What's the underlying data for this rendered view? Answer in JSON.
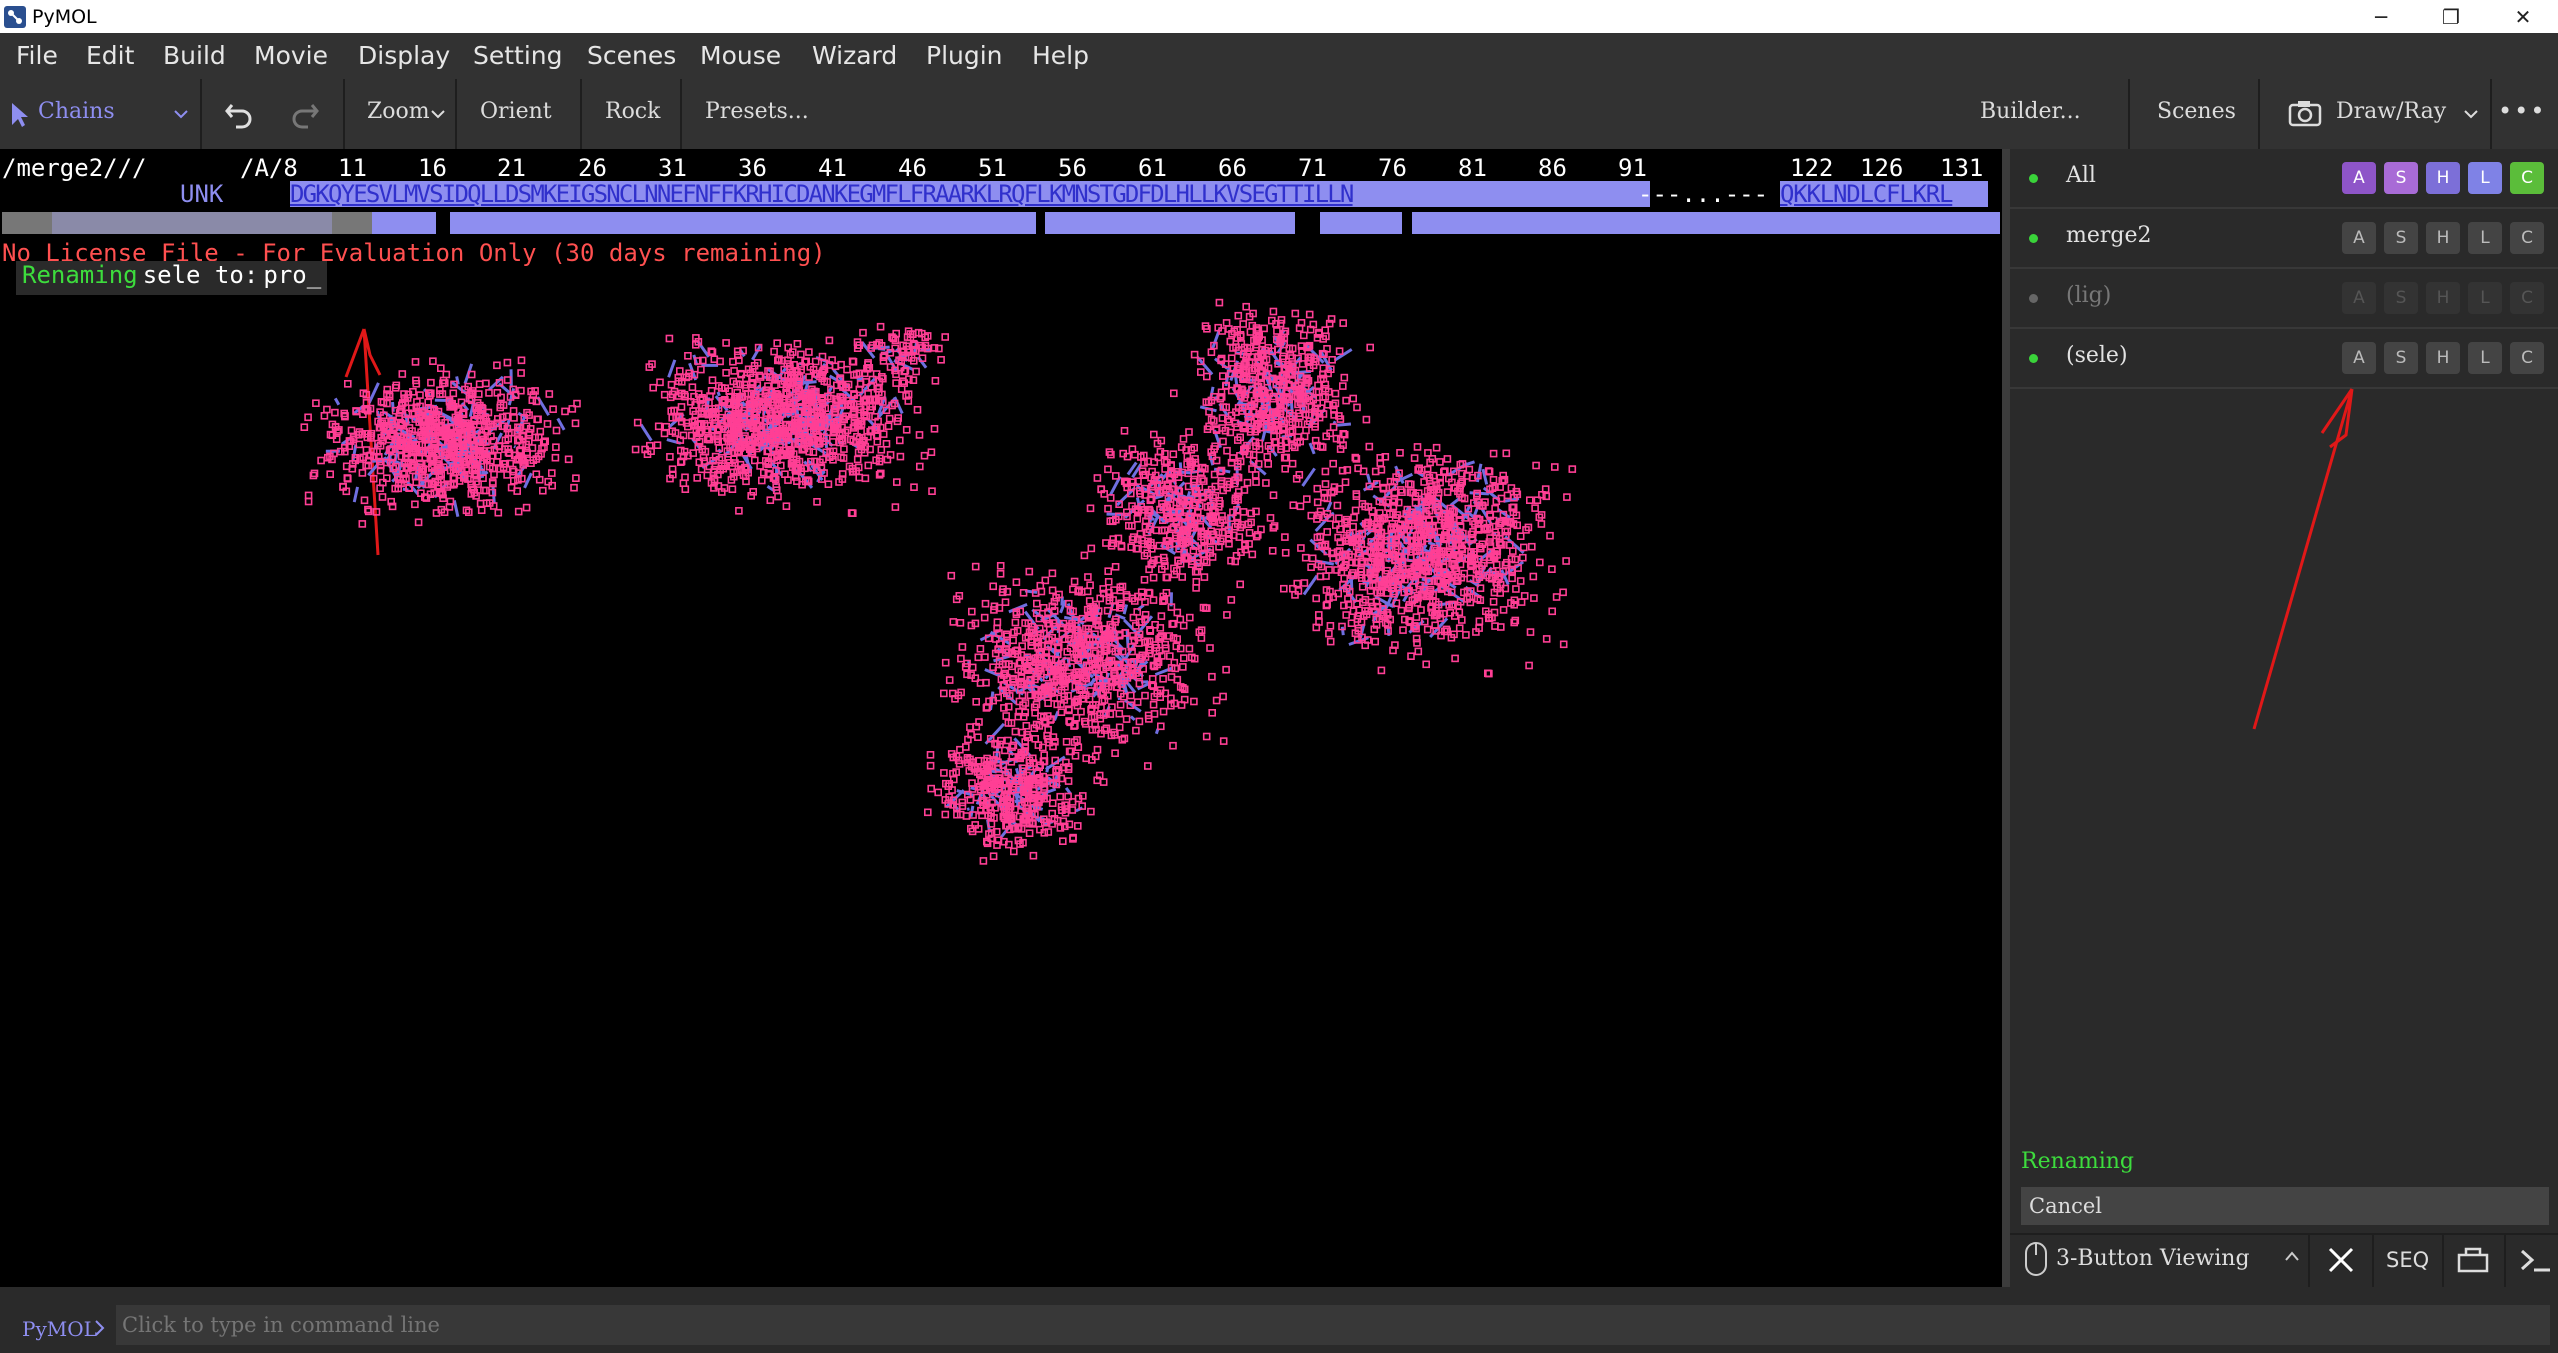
{
  "window": {
    "title": "PyMOL",
    "minimize": "─",
    "maximize": "❐",
    "close": "✕"
  },
  "menu": [
    "File",
    "Edit",
    "Build",
    "Movie",
    "Display",
    "Setting",
    "Scenes",
    "Mouse",
    "Wizard",
    "Plugin",
    "Help"
  ],
  "toolbar": {
    "selection_mode": "Chains",
    "zoom": "Zoom",
    "orient": "Orient",
    "rock": "Rock",
    "presets": "Presets...",
    "builder": "Builder...",
    "scenes": "Scenes",
    "draw_ray": "Draw/Ray",
    "more": "•••"
  },
  "sequence": {
    "object_label": "/merge2///",
    "chain_label": "/A/8",
    "resnums": [
      "11",
      "16",
      "21",
      "26",
      "31",
      "36",
      "41",
      "46",
      "51",
      "56",
      "61",
      "66",
      "71",
      "76",
      "81",
      "86",
      "91",
      "122",
      "126",
      "131"
    ],
    "molecule": "UNK",
    "seq_main": "DGKQYESVLMVSIDQLLDSMKEIGSNCLNNEFNFFKRHICDANKEGMFLFRAARKLRQFLKMNSTGDFDLHLLKVSEGTTILLN",
    "seq_gap": "---...---",
    "seq_end": "QKKLNDLCFLKRL"
  },
  "viewer": {
    "license_msg": "No License File - For Evaluation Only (30 days remaining)",
    "rename_prefix": "Renaming",
    "rename_mid": "sele to:",
    "rename_value": "pro_"
  },
  "objects": [
    {
      "name": "All",
      "enabled": true,
      "colored": true
    },
    {
      "name": "merge2",
      "enabled": true,
      "colored": false
    },
    {
      "name": "(lig)",
      "enabled": false,
      "colored": false
    },
    {
      "name": "(sele)",
      "enabled": true,
      "colored": false
    }
  ],
  "ashlc": [
    "A",
    "S",
    "H",
    "L",
    "C"
  ],
  "ashlc_colors": [
    "#8e55c8",
    "#a86bd6",
    "#7c6fd8",
    "#7f82e6",
    "#5bbd3a"
  ],
  "wizard": {
    "title": "Renaming",
    "cancel": "Cancel"
  },
  "bottom": {
    "mouse_mode": "3-Button Viewing",
    "seq": "SEQ"
  },
  "cmd": {
    "prompt": "PyMOL",
    "placeholder": "Click to type in command line"
  },
  "colors": {
    "accent_purple": "#8e8ef0",
    "license_red": "#ff5050",
    "rename_green": "#3ddc3d",
    "atom_pink": "#ff3f95"
  }
}
